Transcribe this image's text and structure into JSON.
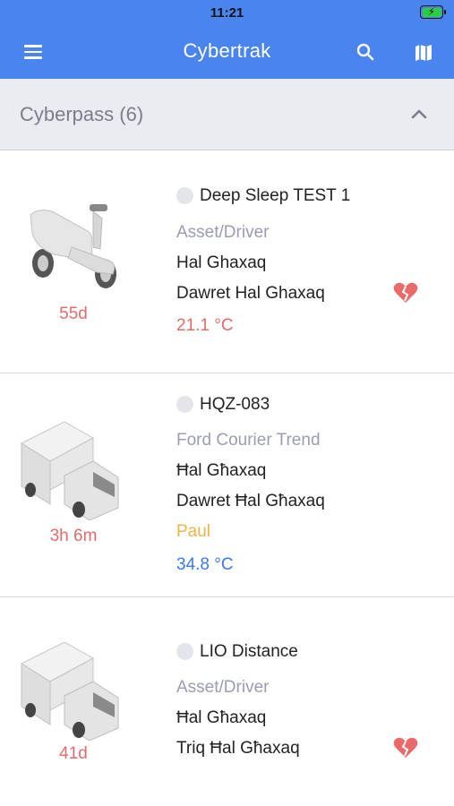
{
  "status_bar": {
    "time": "11:21",
    "battery_icon": "battery-charging-icon"
  },
  "app_bar": {
    "title": "Cybertrak",
    "menu_icon": "hamburger-menu-icon",
    "search_icon": "search-icon",
    "map_icon": "map-icon"
  },
  "group": {
    "label": "Cyberpass (6)",
    "chevron_icon": "chevron-up-icon"
  },
  "colors": {
    "primary": "#4a84ee",
    "age_red": "#e06c6c",
    "asset_label": "#9a9cb3",
    "driver_yellow": "#e8b44a",
    "temp_blue": "#3b7be0"
  },
  "assets": [
    {
      "name": "Deep Sleep TEST 1",
      "subtitle": "Asset/Driver",
      "city": "Hal Ghaxaq",
      "street": "Dawret Hal Ghaxaq",
      "temperature": "21.1 °C",
      "age": "55d",
      "vehicle_icon": "scooter-icon",
      "status_icon": "broken-heart-icon"
    },
    {
      "name": "HQZ-083",
      "subtitle": "Ford Courier Trend",
      "city": "Ħal Għaxaq",
      "street": "Dawret Ħal Għaxaq",
      "driver": "Paul",
      "temperature": "34.8 °C",
      "age": "3h 6m",
      "vehicle_icon": "truck-icon"
    },
    {
      "name": "LIO Distance",
      "subtitle": "Asset/Driver",
      "city": "Ħal Għaxaq",
      "street": "Triq Ħal Għaxaq",
      "age": "41d",
      "vehicle_icon": "truck-icon",
      "status_icon": "broken-heart-icon"
    }
  ]
}
